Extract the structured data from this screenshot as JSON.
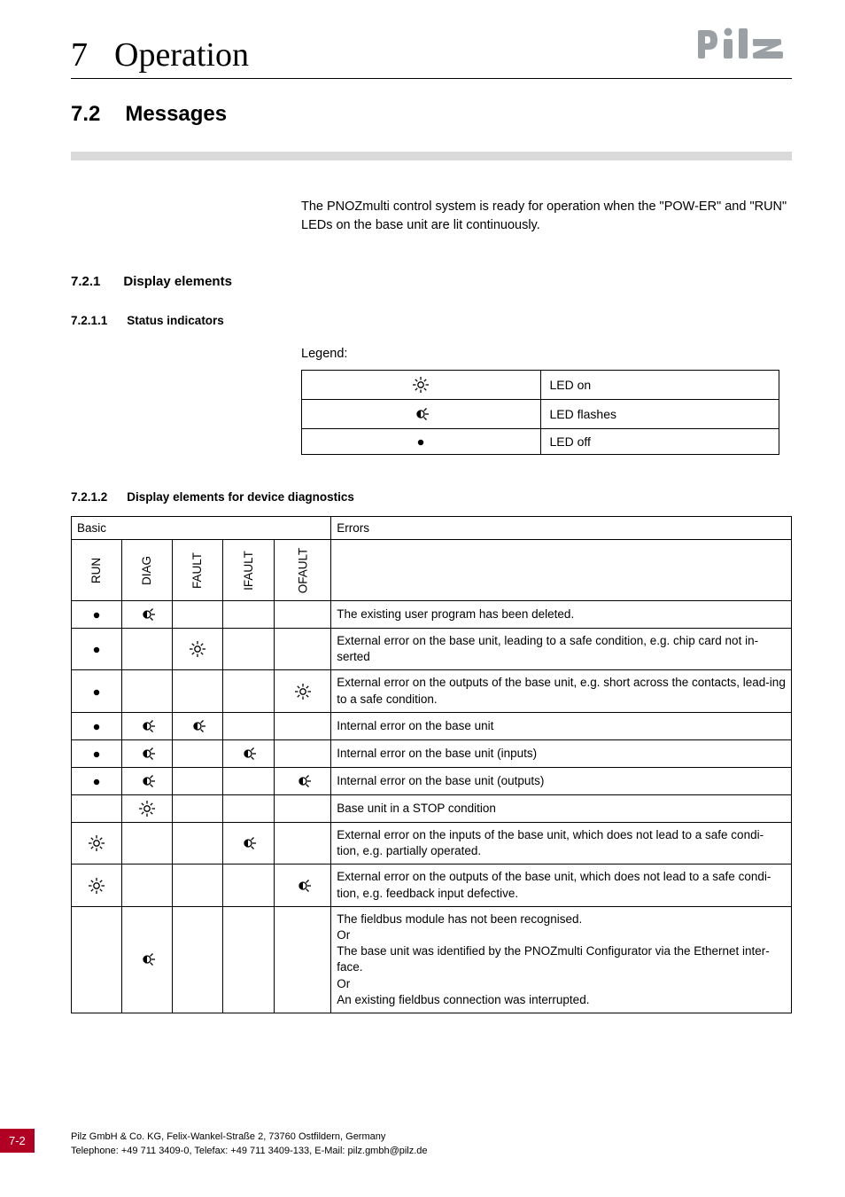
{
  "page_number": "7-2",
  "chapter": {
    "number": "7",
    "title": "Operation"
  },
  "section": {
    "number": "7.2",
    "title": "Messages"
  },
  "intro": "The PNOZmulti control system is ready for operation when the \"POW-ER\" and \"RUN\" LEDs on the base unit are lit continuously.",
  "sub": {
    "number": "7.2.1",
    "title": "Display elements"
  },
  "subsub1": {
    "number": "7.2.1.1",
    "title": "Status indicators"
  },
  "legend_label": "Legend:",
  "legend": [
    {
      "sym": "on",
      "text": "LED on"
    },
    {
      "sym": "flash",
      "text": "LED flashes"
    },
    {
      "sym": "off",
      "text": "LED off"
    }
  ],
  "subsub2": {
    "number": "7.2.1.2",
    "title": "Display elements for device diagnostics"
  },
  "diag": {
    "group_labels": {
      "basic": "Basic",
      "errors": "Errors"
    },
    "cols": [
      "RUN",
      "DIAG",
      "FAULT",
      "IFAULT",
      "OFAULT"
    ],
    "rows": [
      {
        "c": [
          "off",
          "flash",
          "",
          "",
          ""
        ],
        "err": "The existing user program has been deleted."
      },
      {
        "c": [
          "off",
          "",
          "on",
          "",
          ""
        ],
        "err": "External error on the base unit, leading to a safe condition, e.g. chip card not in-serted"
      },
      {
        "c": [
          "off",
          "",
          "",
          "",
          "on"
        ],
        "err": "External error on the outputs of the base unit, e.g. short across the contacts, lead-ing to a safe condition."
      },
      {
        "c": [
          "off",
          "flash",
          "flash",
          "",
          ""
        ],
        "err": "Internal error on the base unit"
      },
      {
        "c": [
          "off",
          "flash",
          "",
          "flash",
          ""
        ],
        "err": "Internal error on the base unit (inputs)"
      },
      {
        "c": [
          "off",
          "flash",
          "",
          "",
          "flash"
        ],
        "err": "Internal error on the base unit (outputs)"
      },
      {
        "c": [
          "",
          "on",
          "",
          "",
          ""
        ],
        "err": "Base unit in a STOP condition"
      },
      {
        "c": [
          "on",
          "",
          "",
          "flash",
          ""
        ],
        "err": "External error on the inputs of the base unit, which does not lead to a safe condi-tion, e.g. partially operated."
      },
      {
        "c": [
          "on",
          "",
          "",
          "",
          "flash"
        ],
        "err": "External error on the outputs of the base unit, which does not lead to a safe condi-tion, e.g. feedback input defective."
      },
      {
        "c": [
          "",
          "flash",
          "",
          "",
          ""
        ],
        "err": "The fieldbus module has not been recognised.\nOr\nThe base unit was identified by the PNOZmulti Configurator via the Ethernet inter-face.\nOr\nAn existing fieldbus connection was interrupted."
      }
    ]
  },
  "footer": {
    "line1": "Pilz GmbH & Co. KG, Felix-Wankel-Straße 2, 73760 Ostfildern, Germany",
    "line2": "Telephone: +49 711 3409-0, Telefax: +49 711 3409-133, E-Mail: pilz.gmbh@pilz.de"
  }
}
